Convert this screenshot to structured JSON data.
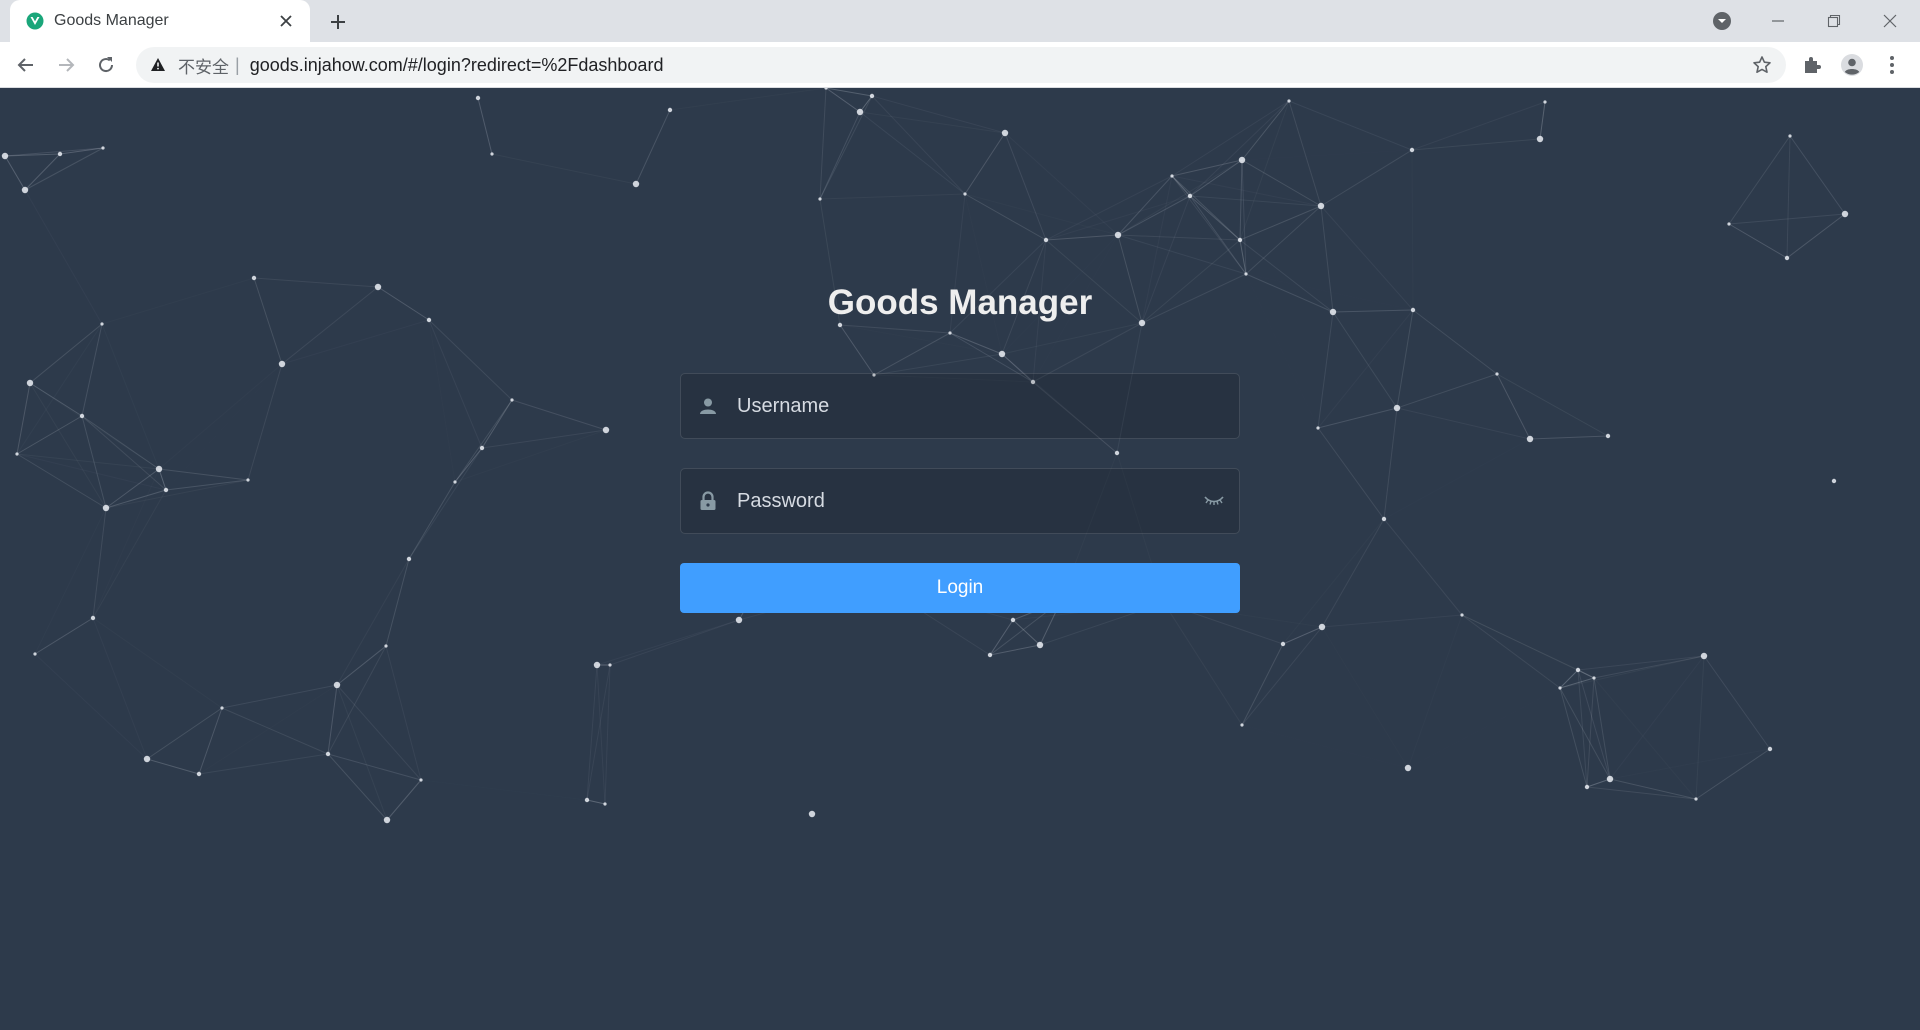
{
  "browser": {
    "tab": {
      "title": "Goods Manager",
      "favicon": "vue-logo-icon"
    },
    "omnibox": {
      "security_label": "不安全",
      "separator": "|",
      "url": "goods.injahow.com/#/login?redirect=%2Fdashboard"
    },
    "icons": {
      "back": "back-arrow-icon",
      "forward": "forward-arrow-icon",
      "reload": "reload-icon",
      "bookmark": "star-icon",
      "extensions": "puzzle-icon",
      "profile": "avatar-icon",
      "menu": "kebab-menu-icon"
    }
  },
  "page": {
    "title": "Goods Manager",
    "username": {
      "value": "",
      "placeholder": "Username"
    },
    "password": {
      "value": "",
      "placeholder": "Password"
    },
    "login_label": "Login",
    "colors": {
      "background": "#2d3a4b",
      "accent": "#409eff",
      "text": "#eeeeee"
    }
  }
}
